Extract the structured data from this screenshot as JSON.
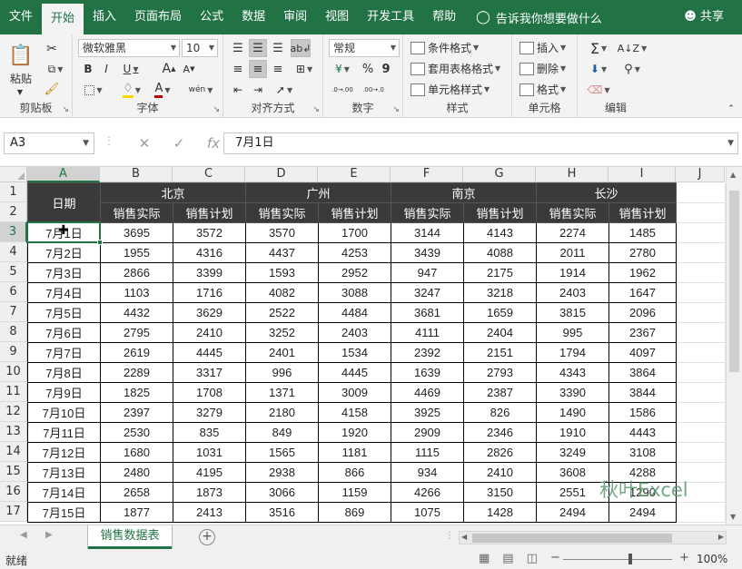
{
  "tabs": [
    "文件",
    "开始",
    "插入",
    "页面布局",
    "公式",
    "数据",
    "审阅",
    "视图",
    "开发工具",
    "帮助"
  ],
  "active_tab_index": 1,
  "tell_me": "告诉我你想要做什么",
  "share": "共享",
  "ribbon": {
    "clipboard": {
      "label": "剪贴板",
      "paste": "粘贴"
    },
    "font": {
      "label": "字体",
      "name": "微软雅黑",
      "size": "10",
      "bold": "B",
      "italic": "I",
      "underline": "U",
      "grow": "A",
      "shrink": "A",
      "font_color_glyph": "A",
      "wen": "wén"
    },
    "alignment": {
      "label": "对齐方式"
    },
    "number": {
      "label": "数字",
      "format": "常规",
      "percent": "%",
      "comma": "9",
      "inc": ".0→.00",
      "dec": ".00→.0"
    },
    "styles": {
      "label": "样式",
      "conditional": "条件格式",
      "table": "套用表格格式",
      "cell": "单元格样式"
    },
    "cells": {
      "label": "单元格",
      "insert": "插入",
      "delete": "删除",
      "format": "格式"
    },
    "editing": {
      "label": "编辑"
    }
  },
  "formula_bar": {
    "name_box": "A3",
    "content": "7月1日",
    "fx": "fx"
  },
  "columns": [
    "A",
    "B",
    "C",
    "D",
    "E",
    "F",
    "G",
    "H",
    "I",
    "J"
  ],
  "selected_column": "A",
  "rows": [
    "1",
    "2",
    "3",
    "4",
    "5",
    "6",
    "7",
    "8",
    "9",
    "10",
    "11",
    "12",
    "13",
    "14",
    "15",
    "16",
    "17"
  ],
  "selected_row": "3",
  "sheet": {
    "date_header": "日期",
    "cities": [
      "北京",
      "广州",
      "南京",
      "长沙"
    ],
    "subheaders": [
      "销售实际",
      "销售计划"
    ],
    "data": [
      [
        "7月1日",
        "3695",
        "3572",
        "3570",
        "1700",
        "3144",
        "4143",
        "2274",
        "1485"
      ],
      [
        "7月2日",
        "1955",
        "4316",
        "4437",
        "4253",
        "3439",
        "4088",
        "2011",
        "2780"
      ],
      [
        "7月3日",
        "2866",
        "3399",
        "1593",
        "2952",
        "947",
        "2175",
        "1914",
        "1962"
      ],
      [
        "7月4日",
        "1103",
        "1716",
        "4082",
        "3088",
        "3247",
        "3218",
        "2403",
        "1647"
      ],
      [
        "7月5日",
        "4432",
        "3629",
        "2522",
        "4484",
        "3681",
        "1659",
        "3815",
        "2096"
      ],
      [
        "7月6日",
        "2795",
        "2410",
        "3252",
        "2403",
        "4111",
        "2404",
        "995",
        "2367"
      ],
      [
        "7月7日",
        "2619",
        "4445",
        "2401",
        "1534",
        "2392",
        "2151",
        "1794",
        "4097"
      ],
      [
        "7月8日",
        "2289",
        "3317",
        "996",
        "4445",
        "1639",
        "2793",
        "4343",
        "3864"
      ],
      [
        "7月9日",
        "1825",
        "1708",
        "1371",
        "3009",
        "4469",
        "2387",
        "3390",
        "3844"
      ],
      [
        "7月10日",
        "2397",
        "3279",
        "2180",
        "4158",
        "3925",
        "826",
        "1490",
        "1586"
      ],
      [
        "7月11日",
        "2530",
        "835",
        "849",
        "1920",
        "2909",
        "2346",
        "1910",
        "4443"
      ],
      [
        "7月12日",
        "1680",
        "1031",
        "1565",
        "1181",
        "1115",
        "2826",
        "3249",
        "3108"
      ],
      [
        "7月13日",
        "2480",
        "4195",
        "2938",
        "866",
        "934",
        "2410",
        "3608",
        "4288"
      ],
      [
        "7月14日",
        "2658",
        "1873",
        "3066",
        "1159",
        "4266",
        "3150",
        "2551",
        "1290"
      ],
      [
        "7月15日",
        "1877",
        "2413",
        "3516",
        "869",
        "1075",
        "1428",
        "2494",
        "2494"
      ]
    ]
  },
  "watermark": "秋叶Excel",
  "sheet_tab": "销售数据表",
  "status": {
    "ready": "就绪",
    "zoom": "100%"
  },
  "colors": {
    "accent": "#217346",
    "header_fill": "#3a3a3a"
  }
}
